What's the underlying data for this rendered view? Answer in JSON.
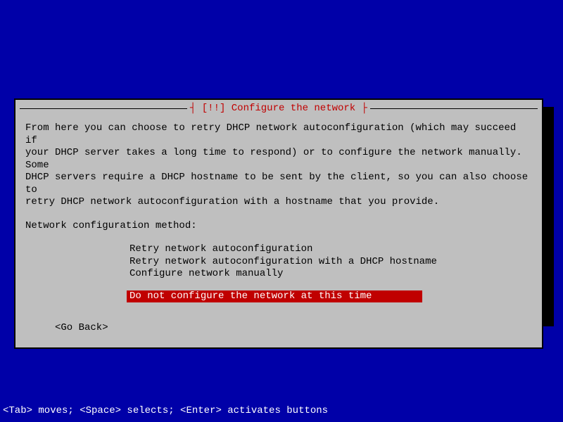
{
  "dialog": {
    "title": "┤ [!!] Configure the network ├",
    "description": "From here you can choose to retry DHCP network autoconfiguration (which may succeed if\nyour DHCP server takes a long time to respond) or to configure the network manually. Some\nDHCP servers require a DHCP hostname to be sent by the client, so you can also choose to\nretry DHCP network autoconfiguration with a hostname that you provide.",
    "prompt": "Network configuration method:",
    "options": [
      "Retry network autoconfiguration",
      "Retry network autoconfiguration with a DHCP hostname",
      "Configure network manually",
      "Do not configure the network at this time"
    ],
    "selected_index": 3,
    "go_back": "<Go Back>"
  },
  "footer": "<Tab> moves; <Space> selects; <Enter> activates buttons"
}
